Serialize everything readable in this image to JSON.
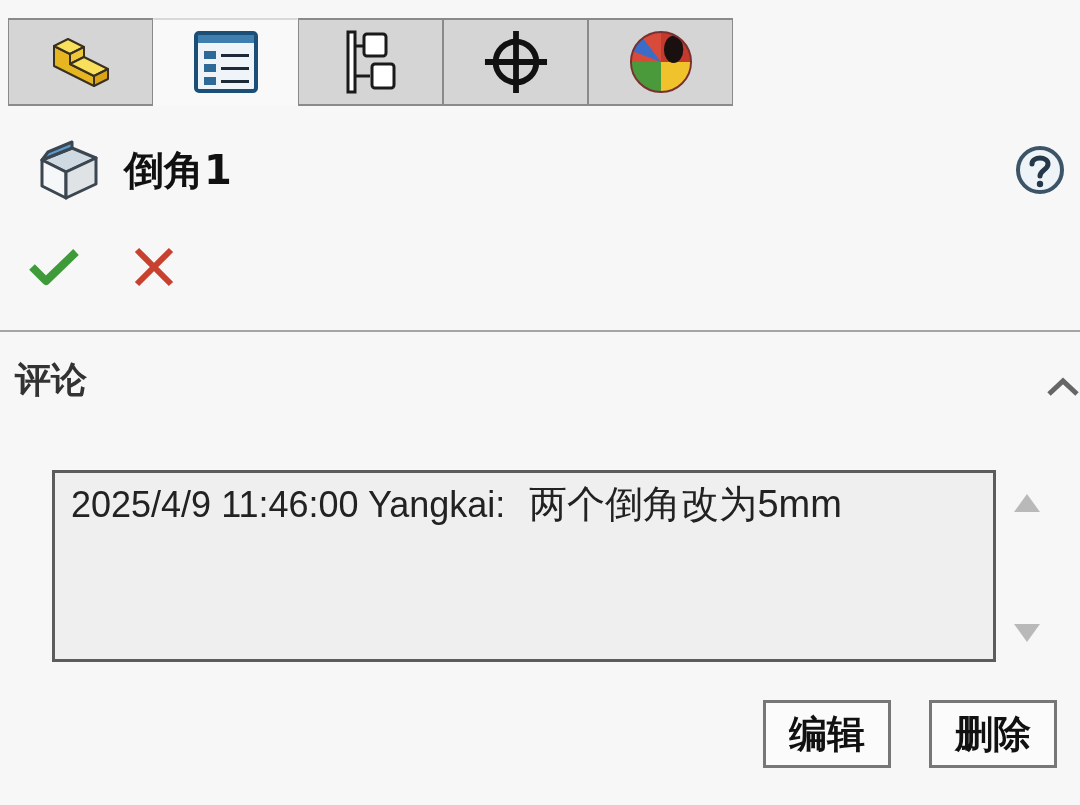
{
  "tabs": [
    {
      "kind": "blocks",
      "selected": false
    },
    {
      "kind": "list",
      "selected": true
    },
    {
      "kind": "tree",
      "selected": false
    },
    {
      "kind": "crosshair",
      "selected": false
    },
    {
      "kind": "sphere",
      "selected": false
    }
  ],
  "feature": {
    "title": "倒角1"
  },
  "section": {
    "title": "评论",
    "expanded": true,
    "comments": [
      {
        "header": "2025/4/9 11:46:00 Yangkai:",
        "text": "两个倒角改为5mm"
      }
    ]
  },
  "buttons": [
    "编辑",
    "删除"
  ]
}
